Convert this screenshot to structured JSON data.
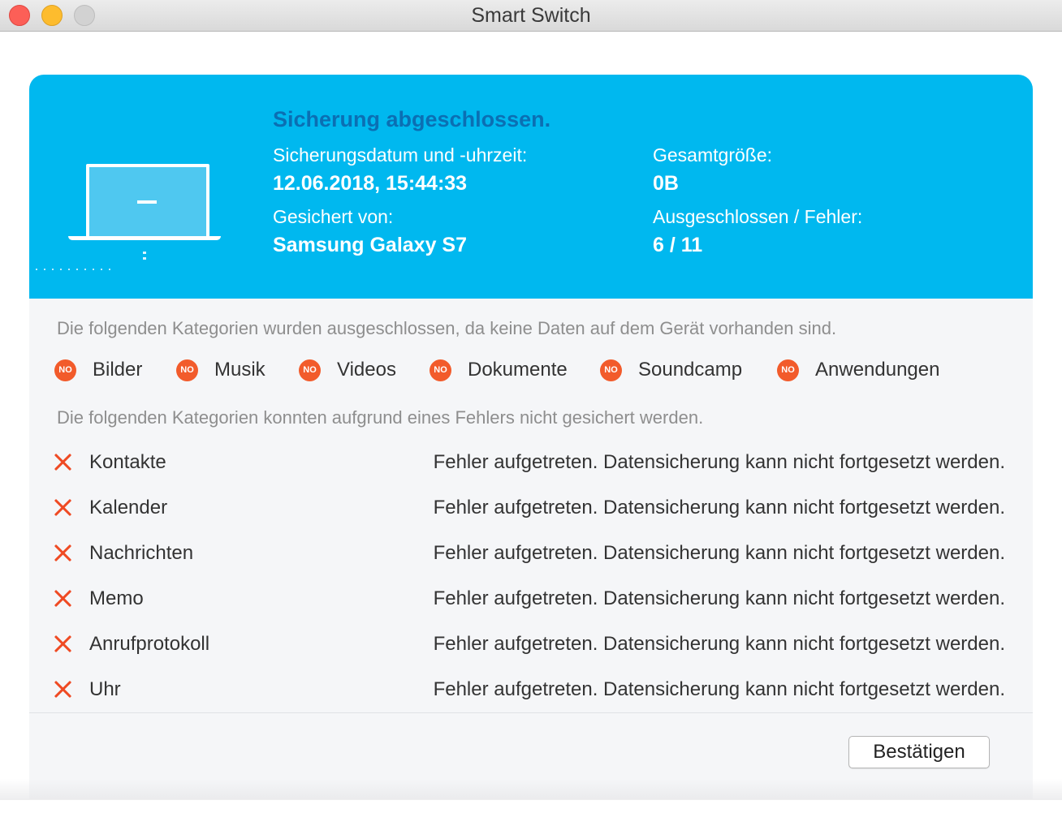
{
  "window": {
    "title": "Smart Switch"
  },
  "summary": {
    "status": "Sicherung abgeschlossen.",
    "backup_date_label": "Sicherungsdatum und -uhrzeit:",
    "backup_date_value": "12.06.2018, 15:44:33",
    "backed_up_by_label": "Gesichert von:",
    "backed_up_by_value": "Samsung Galaxy S7",
    "total_size_label": "Gesamtgröße:",
    "total_size_value": "0B",
    "excluded_errors_label": "Ausgeschlossen / Fehler:",
    "excluded_errors_value": "6 / 11"
  },
  "excluded": {
    "description": "Die folgenden Kategorien wurden ausgeschlossen, da keine Daten auf dem Gerät vorhanden sind.",
    "badge_text": "NO",
    "items": [
      {
        "label": "Bilder"
      },
      {
        "label": "Musik"
      },
      {
        "label": "Videos"
      },
      {
        "label": "Dokumente"
      },
      {
        "label": "Soundcamp"
      },
      {
        "label": "Anwendungen"
      }
    ]
  },
  "errors": {
    "description": "Die folgenden Kategorien konnten aufgrund eines Fehlers nicht gesichert werden.",
    "items": [
      {
        "name": "Kontakte",
        "message": "Fehler aufgetreten. Datensicherung kann nicht fortgesetzt werden."
      },
      {
        "name": "Kalender",
        "message": "Fehler aufgetreten. Datensicherung kann nicht fortgesetzt werden."
      },
      {
        "name": "Nachrichten",
        "message": "Fehler aufgetreten. Datensicherung kann nicht fortgesetzt werden."
      },
      {
        "name": "Memo",
        "message": "Fehler aufgetreten. Datensicherung kann nicht fortgesetzt werden."
      },
      {
        "name": "Anrufprotokoll",
        "message": "Fehler aufgetreten. Datensicherung kann nicht fortgesetzt werden."
      },
      {
        "name": "Uhr",
        "message": "Fehler aufgetreten. Datensicherung kann nicht fortgesetzt werden."
      }
    ]
  },
  "footer": {
    "confirm_label": "Bestätigen"
  },
  "colors": {
    "hero_background": "#00b8ef",
    "status_text": "#0b6fb3",
    "badge": "#f25b2b",
    "error_icon": "#ef4a23"
  },
  "icons": {
    "laptop": "laptop-icon",
    "excluded_badge": "no-badge-icon",
    "error": "error-x-icon"
  }
}
